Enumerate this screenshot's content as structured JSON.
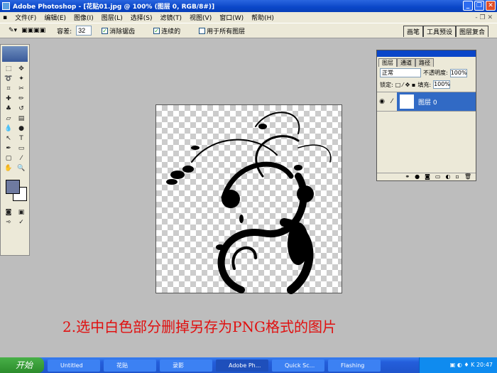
{
  "title": "Adobe Photoshop - [花贴01.jpg @ 100% (图层 0, RGB/8#)]",
  "menu": [
    "文件(F)",
    "编辑(E)",
    "图像(I)",
    "图层(L)",
    "选择(S)",
    "滤镜(T)",
    "视图(V)",
    "窗口(W)",
    "帮助(H)"
  ],
  "options": {
    "tolerance_label": "容差:",
    "tolerance": "32",
    "antialias": "消除锯齿",
    "contiguous": "连续的",
    "all_layers": "用于所有图层",
    "tabs": [
      "画笔",
      "工具预设",
      "图层复合"
    ]
  },
  "layers": {
    "tabs": [
      "图层",
      "通道",
      "路径"
    ],
    "blend": "正常",
    "opacity_label": "不透明度:",
    "opacity": "100%",
    "lock_label": "锁定:",
    "fill_label": "填充:",
    "fill": "100%",
    "layer_name": "图层 0"
  },
  "caption": "2.选中白色部分删掉另存为PNG格式的图片",
  "taskbar": {
    "start": "开始",
    "tasks": [
      "Untitled",
      "花贴",
      "录影",
      "Adobe Ph...",
      "Quick Sc...",
      "Flashing"
    ],
    "clock": "20:47"
  }
}
